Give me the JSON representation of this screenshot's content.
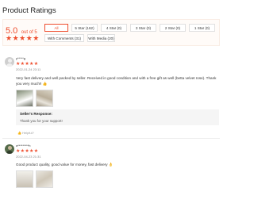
{
  "page_title": "Product Ratings",
  "summary": {
    "score": "5.0",
    "out_of": "out of 5",
    "stars": "★★★★★"
  },
  "filters": [
    {
      "label": "All",
      "active": true
    },
    {
      "label": "5 Star (162)",
      "active": false
    },
    {
      "label": "4 Star (0)",
      "active": false
    },
    {
      "label": "3 Star (0)",
      "active": false
    },
    {
      "label": "2 Star (0)",
      "active": false
    },
    {
      "label": "1 Star (0)",
      "active": false
    },
    {
      "label": "With Comments (31)",
      "active": false
    },
    {
      "label": "With Media (20)",
      "active": false
    }
  ],
  "reviews": [
    {
      "username": "y*****g",
      "stars": "★★★★★",
      "date": "2022-01-24 23:11",
      "text": "Very fast delivery and well packed by seller. Received in good condition and with a free gift as well (betta velvet rose). Thank you very much!! 👍",
      "response_title": "Seller's Response:",
      "response_text": "Thank you for your support!",
      "helpful": "👍 Helpful?"
    },
    {
      "username": "a*********h",
      "stars": "★★★★★",
      "date": "2022-04-23 21:31",
      "text": "Good product quality, good value for money, fast delivery 👌"
    }
  ],
  "colors": {
    "accent": "#ee4d2d",
    "summary_bg": "#fffbf8",
    "response_bg": "#f5f5f5"
  }
}
